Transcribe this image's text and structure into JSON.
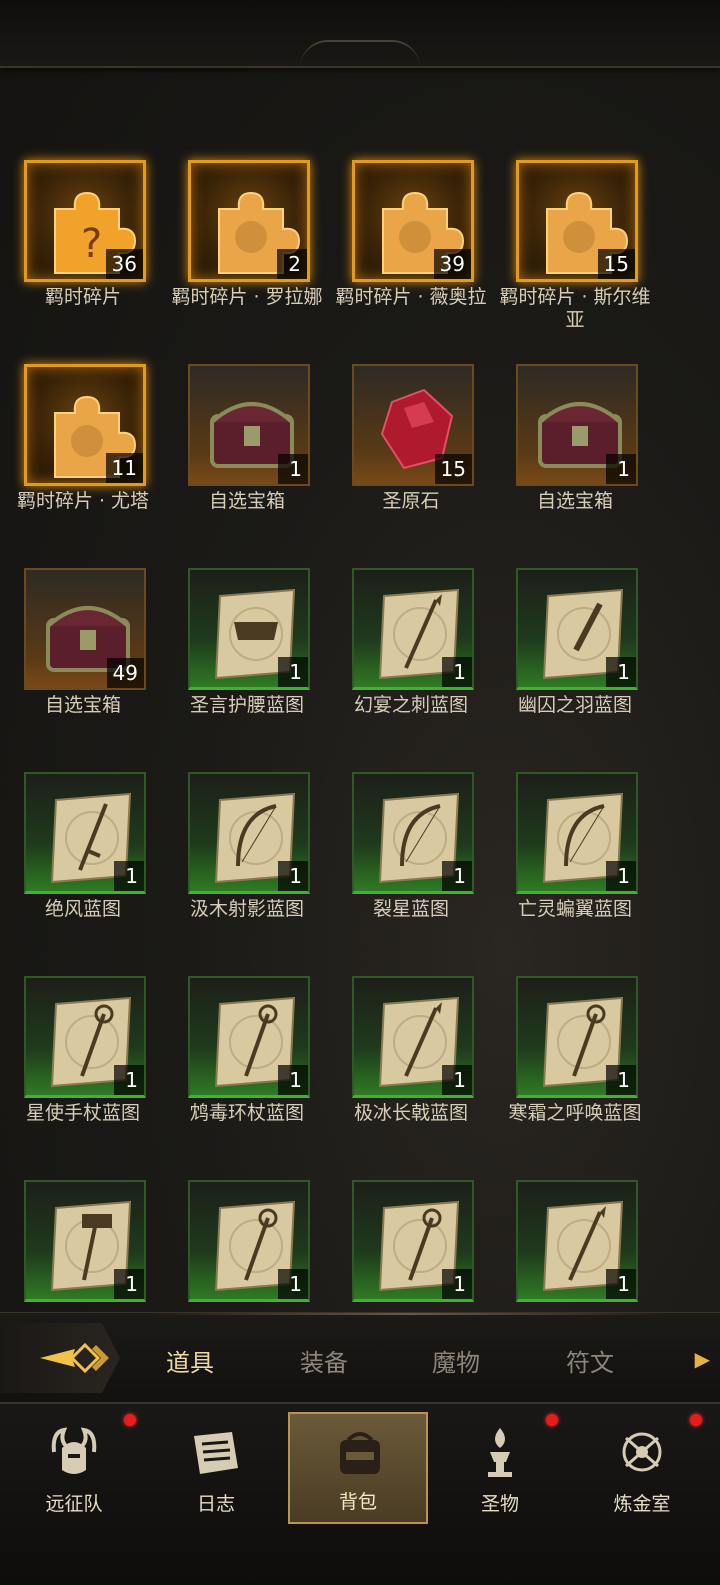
{
  "items": [
    {
      "label": "羁时碎片",
      "count": "36",
      "type": "puzzle-q",
      "frame": "gold"
    },
    {
      "label": "羁时碎片 · 罗拉娜",
      "count": "2",
      "type": "puzzle",
      "frame": "gold"
    },
    {
      "label": "羁时碎片 · 薇奥拉",
      "count": "39",
      "type": "puzzle",
      "frame": "gold"
    },
    {
      "label": "羁时碎片 · 斯尔维亚",
      "count": "15",
      "type": "puzzle",
      "frame": "gold"
    },
    {
      "label": "羁时碎片 · 尤塔",
      "count": "11",
      "type": "puzzle",
      "frame": "gold"
    },
    {
      "label": "自选宝箱",
      "count": "1",
      "type": "chest",
      "frame": "orange"
    },
    {
      "label": "圣原石",
      "count": "15",
      "type": "gem",
      "frame": "orange"
    },
    {
      "label": "自选宝箱",
      "count": "1",
      "type": "chest",
      "frame": "orange"
    },
    {
      "label": "自选宝箱",
      "count": "49",
      "type": "chest",
      "frame": "orange"
    },
    {
      "label": "圣言护腰蓝图",
      "count": "1",
      "type": "scroll-belt",
      "frame": "green"
    },
    {
      "label": "幻宴之刺蓝图",
      "count": "1",
      "type": "scroll-spear",
      "frame": "green"
    },
    {
      "label": "幽囚之羽蓝图",
      "count": "1",
      "type": "scroll-dagger",
      "frame": "green"
    },
    {
      "label": "绝风蓝图",
      "count": "1",
      "type": "scroll-sword",
      "frame": "green"
    },
    {
      "label": "汲木射影蓝图",
      "count": "1",
      "type": "scroll-bow",
      "frame": "green"
    },
    {
      "label": "裂星蓝图",
      "count": "1",
      "type": "scroll-bow",
      "frame": "green"
    },
    {
      "label": "亡灵蝙翼蓝图",
      "count": "1",
      "type": "scroll-bow",
      "frame": "green"
    },
    {
      "label": "星使手杖蓝图",
      "count": "1",
      "type": "scroll-staff",
      "frame": "green"
    },
    {
      "label": "鸩毒环杖蓝图",
      "count": "1",
      "type": "scroll-staff",
      "frame": "green"
    },
    {
      "label": "极冰长戟蓝图",
      "count": "1",
      "type": "scroll-spear",
      "frame": "green"
    },
    {
      "label": "寒霜之呼唤蓝图",
      "count": "1",
      "type": "scroll-staff",
      "frame": "green"
    },
    {
      "label": "",
      "count": "1",
      "type": "scroll-hammer",
      "frame": "green"
    },
    {
      "label": "",
      "count": "1",
      "type": "scroll-staff",
      "frame": "green"
    },
    {
      "label": "",
      "count": "1",
      "type": "scroll-staff",
      "frame": "green"
    },
    {
      "label": "",
      "count": "1",
      "type": "scroll-spear",
      "frame": "green"
    }
  ],
  "category_tabs": {
    "active": "道具",
    "labels": [
      "道具",
      "装备",
      "魔物",
      "符文"
    ]
  },
  "nav": {
    "labels": [
      "远征队",
      "日志",
      "背包",
      "圣物",
      "炼金室"
    ],
    "active": "背包",
    "icons": [
      "helmet-icon",
      "journal-icon",
      "backpack-icon",
      "relic-icon",
      "alchemy-icon"
    ],
    "dots": [
      true,
      false,
      false,
      true,
      true
    ]
  },
  "colors": {
    "gold_frame": "#e39b1e",
    "green_frame": "#44b030",
    "accent": "#e5b43c",
    "badge_red": "#e51d1d"
  }
}
